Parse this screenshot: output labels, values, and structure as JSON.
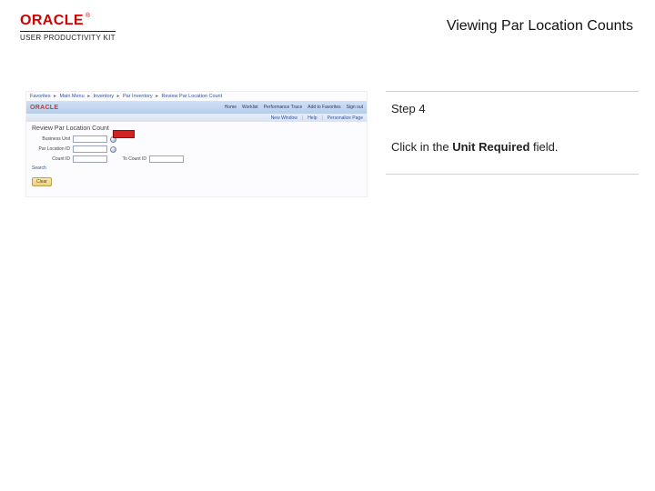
{
  "header": {
    "brand": "ORACLE",
    "brand_tm": "®",
    "subtitle": "USER PRODUCTIVITY KIT",
    "title": "Viewing Par Location Counts"
  },
  "instructions": {
    "step_label": "Step 4",
    "body_prefix": "Click in the ",
    "body_bold": "Unit Required",
    "body_suffix": " field."
  },
  "mini": {
    "breadcrumb": {
      "items": [
        "Favorites",
        "Main Menu",
        "Inventory",
        "Par Inventory",
        "Review Par Location Count"
      ]
    },
    "oracle": "ORACLE",
    "tabs": [
      "Home",
      "Worklist",
      "Performance Trace",
      "Add to Favorites",
      "Sign out"
    ],
    "subbar": [
      "New Window",
      "Help",
      "Personalize Page"
    ],
    "heading": "Review Par Location Count",
    "labels": {
      "business_unit": "Business Unit",
      "par_location": "Par Location ID",
      "count_id": "Count ID",
      "to_count_id": "To Count ID"
    },
    "search_link": "Search",
    "clear_button": "Clear"
  }
}
